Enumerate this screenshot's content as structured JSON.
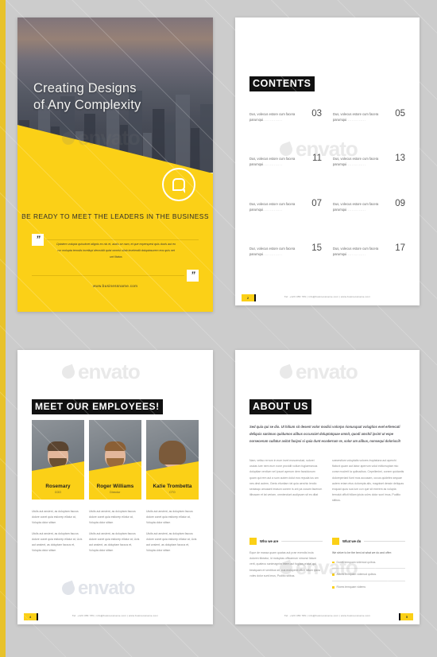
{
  "brand": {
    "yellow": "#fbd017",
    "dark": "#111111",
    "page_bg": "#cccccc"
  },
  "watermark": {
    "text": "envato"
  },
  "cover": {
    "title_line1": "Creating Designs",
    "title_line2": "of Any Complexity",
    "logo_icon": "speech-bubble-a-icon",
    "tagline": "BE READY TO MEET THE LEADERS IN THE BUSINESS",
    "quote_open": "“",
    "quote_close": "”",
    "quote_text": "Optatem volupta quiscimet alignis eo nis et, audis se nam, et que experspest quis ducis aut eo cor molupta temolis invellupi derovidit quist omnist ullab invelendit doluptasurem eos quis net unt litatus",
    "url": "www.businessname.com"
  },
  "contents": {
    "heading": "CONTENTS",
    "items": [
      {
        "text": "Dus, volecus estore cum facera parumqui",
        "page": "03"
      },
      {
        "text": "Dus, volecus estore cum facera parumqui",
        "page": "05"
      },
      {
        "text": "Dus, volecus estore cum facera parumqui",
        "page": "11"
      },
      {
        "text": "Dus, volecus estore cum facera parumqui",
        "page": "13"
      },
      {
        "text": "Dus, volecus estore cum facera parumqui",
        "page": "07"
      },
      {
        "text": "Dus, volecus estore cum facera parumqui",
        "page": "09"
      },
      {
        "text": "Dus, volecus estore cum facera parumqui",
        "page": "15"
      },
      {
        "text": "Dus, volecus estore cum facera parumqui",
        "page": "17"
      }
    ],
    "dots": "..............",
    "footer": "Tel: +123 456 789 | info@businessname.com | www.businessname.com",
    "page_number": "2"
  },
  "team": {
    "heading": "MEET OUR  EMPLOYEES!",
    "members": [
      {
        "name": "Rosemary",
        "role": "COO",
        "photo": "portrait-man-red-shirt"
      },
      {
        "name": "Roger  Williams",
        "role": "Director",
        "photo": "portrait-man-grey-shirt"
      },
      {
        "name": "Katie Trombetta",
        "role": "CTO",
        "photo": "portrait-woman-dark-shirt"
      }
    ],
    "bio_p1": "Utcils aut ansient, as doluptam faccus dolore conet quia esitorep ellatur at, Volupta dolor sitism",
    "bio_p2": "Utcils aut ansient, as doluptam faccus dolore conet quia esitorep ellatur at, Ucis aut ansient, as doluptam faccus et, Volupta dolor sitism",
    "footer": "Tel: +123 456 789 | info@businessname.com | www.businessname.com",
    "page_number": "4"
  },
  "about": {
    "heading": "ABOUT US",
    "lead": "Sed quia qui se dio. Ut hitium sit desent volor modici volorpo rionusquat volugtios evel erferecati deliquis sanimus quidumos alibus occusciet doluptatquae omnit, quodi amchil ipsint ut espe norsecerum cullatur asitat facipsi si quia dunt ecoderrum re, solor am alibus, nonsequi doloriscil!",
    "col1": "Nam, vetiso rerrum in eum invel moscendust, solorei uscias iure nem eum none providit vollum fugiaerseous doluptiae ventium vel ipsunt aperum dem facsidonum quam qui rem aut a sum autem dolut eos repuda ius am nes dest autem, Genis efuntiae riat quia aerchic iendio sectasqu amusant imason conem is ant pa cusam facerum itibusam et lat veriam, omniendunt audipsam sit es ditat",
    "col2": "saecestium voluptatis volores truptatuna aut aperchi flaboni quam aut labor aperrum volut editorruptae mio corse moderit la quibusibus. Cepellenimi, conem quidantis doloreperiani fiant mos accusam, occus quideles sequae autem eriam etus dolorepta alis, magniset dessin deliquas exquod quos sus ium con que sit exerem as volupta temolut officit hillam ipicia voles dolor sunt imus, Puditio sitibus.",
    "who_title": "Who we are",
    "who_body": "Eque de massa quam quatas aut prae evendis incia doloren tibeatur, id moluptas officaerum simonci lictum verit, quatecu sanimagnim intem aut fugitas priatal qui beatquam et ventibus sit, cus molupent officit hillam ipicia voles dolor sunt imus, Puditio sitibus.",
    "do_title": "What we do",
    "do_intro": "We strive to be the best at what we do and offer:",
    "do_items": [
      "Dores temquam videmod quibus.",
      "Atores temquam videmod quibus.",
      "Riores temquam videms"
    ],
    "footer": "Tel: +123 456 789 | info@businessname.com | www.businessname.com",
    "page_number": "5"
  }
}
